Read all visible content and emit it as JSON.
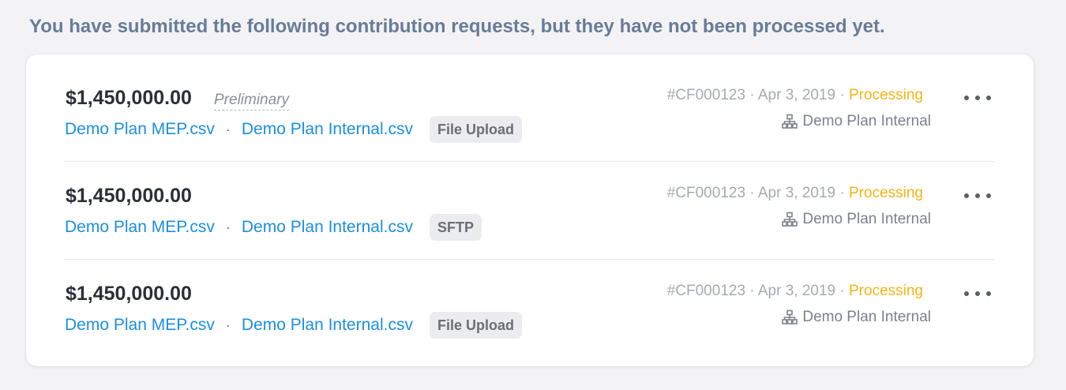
{
  "notice": "You have submitted the following contribution requests, but they have not been processed yet.",
  "requests": [
    {
      "amount": "$1,450,000.00",
      "preliminary_label": "Preliminary",
      "file1": "Demo Plan MEP.csv",
      "separator": "·",
      "file2": "Demo Plan Internal.csv",
      "method": "File Upload",
      "meta_id": "#CF000123",
      "meta_dot1": " · ",
      "meta_date": "Apr 3, 2019",
      "meta_dot2": " · ",
      "status": "Processing",
      "plan": "Demo Plan Internal"
    },
    {
      "amount": "$1,450,000.00",
      "file1": "Demo Plan MEP.csv",
      "separator": "·",
      "file2": "Demo Plan Internal.csv",
      "method": "SFTP",
      "meta_id": "#CF000123",
      "meta_dot1": " · ",
      "meta_date": "Apr 3, 2019",
      "meta_dot2": " · ",
      "status": "Processing",
      "plan": "Demo Plan Internal"
    },
    {
      "amount": "$1,450,000.00",
      "file1": "Demo Plan MEP.csv",
      "separator": "·",
      "file2": "Demo Plan Internal.csv",
      "method": "File Upload",
      "meta_id": "#CF000123",
      "meta_dot1": " · ",
      "meta_date": "Apr 3, 2019",
      "meta_dot2": " · ",
      "status": "Processing",
      "plan": "Demo Plan Internal"
    }
  ],
  "colors": {
    "link": "#1a8fe3",
    "status_processing": "#f5b415",
    "notice_text": "#687c98"
  },
  "icons": {
    "plan_icon": "org-chart-icon",
    "more_icon": "more-horizontal-icon"
  }
}
